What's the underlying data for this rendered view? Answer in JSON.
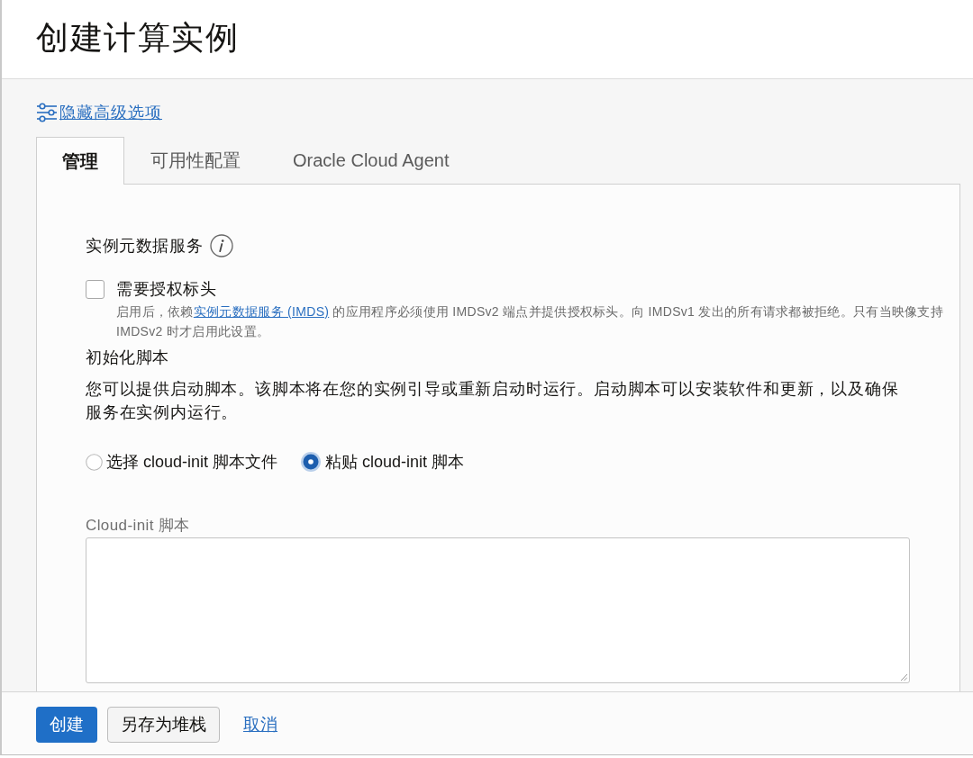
{
  "page": {
    "title": "创建计算实例"
  },
  "advanced_toggle": {
    "label": "隐藏高级选项"
  },
  "tabs": [
    {
      "label": "管理",
      "selected": true
    },
    {
      "label": "可用性配置",
      "selected": false
    },
    {
      "label": "Oracle Cloud Agent",
      "selected": false
    }
  ],
  "metadata_service": {
    "heading": "实例元数据服务",
    "require_auth_header": {
      "label": "需要授权标头",
      "checked": false,
      "help_before": "启用后，依赖",
      "help_link": "实例元数据服务 (IMDS)",
      "help_after": " 的应用程序必须使用 IMDSv2 端点并提供授权标头。向 IMDSv1 发出的所有请求都被拒绝。只有当映像支持 IMDSv2 时才启用此设置。"
    }
  },
  "init_script": {
    "heading": "初始化脚本",
    "description": "您可以提供启动脚本。该脚本将在您的实例引导或重新启动时运行。启动脚本可以安装软件和更新，以及确保服务在实例内运行。",
    "options": [
      {
        "label": "选择 cloud-init 脚本文件",
        "selected": false
      },
      {
        "label": "粘贴 cloud-init 脚本",
        "selected": true
      }
    ],
    "script_field": {
      "label": "Cloud-init 脚本"
    }
  },
  "footer": {
    "buttons": [
      {
        "label": "创建",
        "kind": "primary"
      },
      {
        "label": "另存为堆栈",
        "kind": "secondary"
      },
      {
        "label": "取消",
        "kind": "link"
      }
    ]
  }
}
